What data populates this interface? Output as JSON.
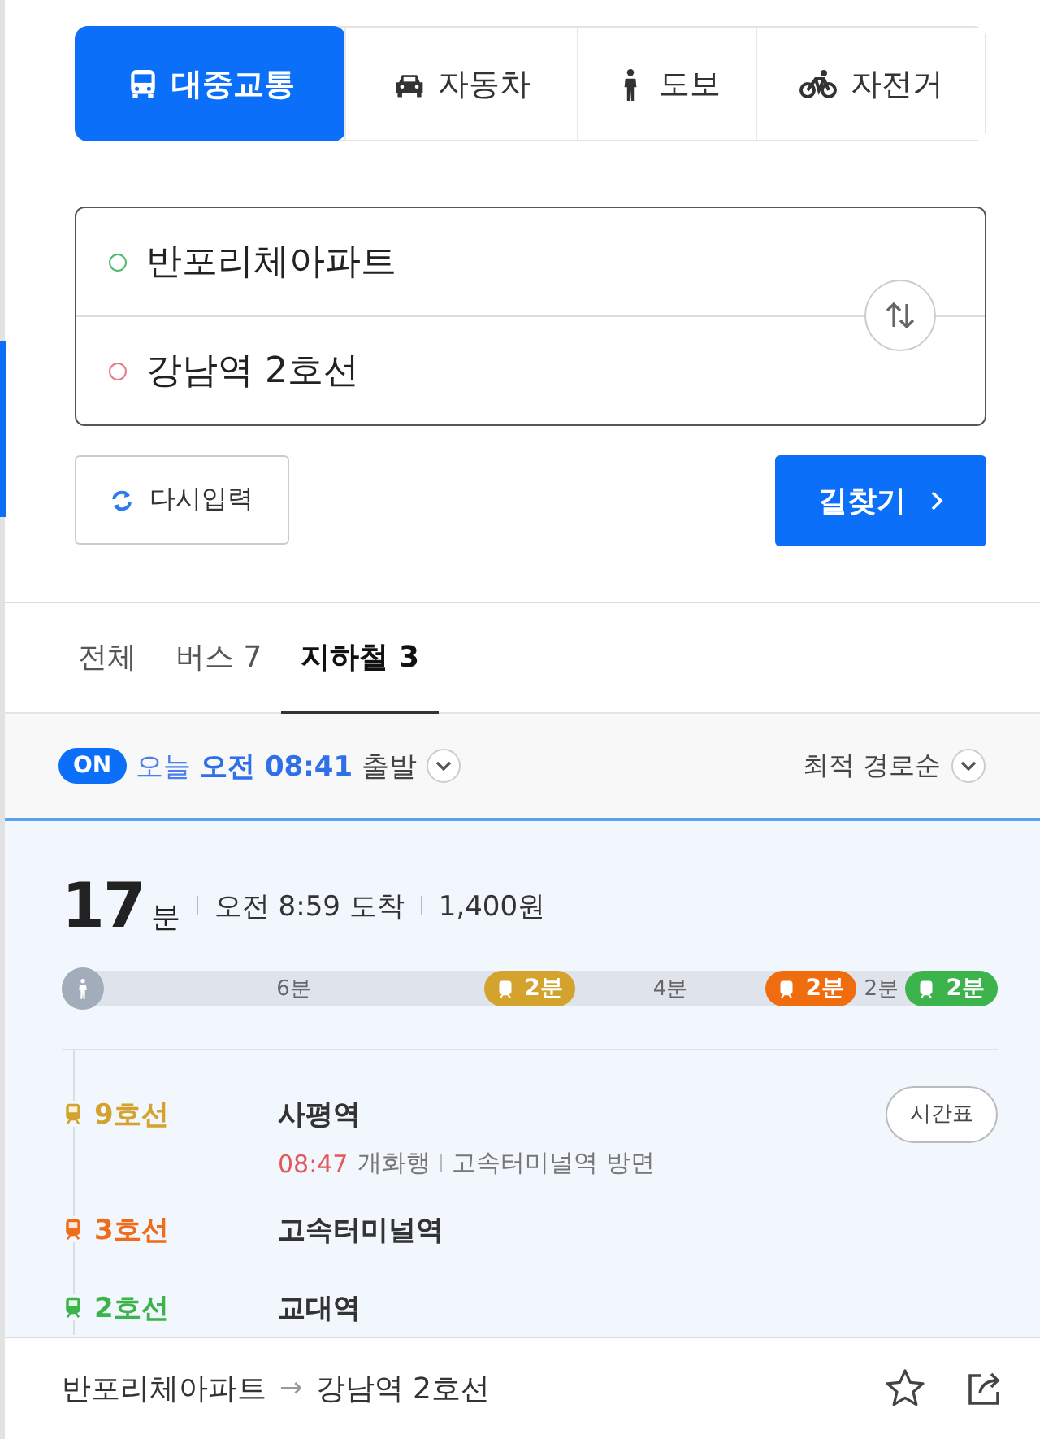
{
  "modes": [
    {
      "kind": "transit",
      "label": "대중교통",
      "selected": true
    },
    {
      "kind": "car",
      "label": "자동차",
      "selected": false
    },
    {
      "kind": "walk",
      "label": "도보",
      "selected": false
    },
    {
      "kind": "bike",
      "label": "자전거",
      "selected": false
    }
  ],
  "route_inputs": {
    "origin": "반포리체아파트",
    "destination": "강남역 2호선"
  },
  "reset_button": "다시입력",
  "search_button": "길찾기",
  "result_tabs": [
    {
      "label": "전체",
      "selected": false
    },
    {
      "label": "버스 7",
      "selected": false
    },
    {
      "label": "지하철 3",
      "selected": true
    }
  ],
  "departure": {
    "toggle": "ON",
    "on": true,
    "day": "오늘",
    "time": "오전 08:41",
    "suffix": "출발"
  },
  "sort": "최적 경로순",
  "route": {
    "duration": "17",
    "duration_unit": "분",
    "arrival": "오전 8:59 도착",
    "fare": "1,400원",
    "segments": [
      {
        "kind": "walk",
        "color": "#a3acbb",
        "label": "6분"
      },
      {
        "kind": "subway",
        "color": "#d4a32e",
        "badge": "2분",
        "label": "4분"
      },
      {
        "kind": "subway",
        "color": "#ef6c0f",
        "badge": "2분",
        "label": "2분"
      },
      {
        "kind": "subway",
        "color": "#3cb44b",
        "badge": "2분"
      }
    ],
    "steps": [
      {
        "line": "9호선",
        "color": "#d4a32e",
        "station": "사평역",
        "timetable": "시간표",
        "detail": {
          "time": "08:47",
          "direction": "개화행",
          "toward": "고속터미널역 방면"
        }
      },
      {
        "line": "3호선",
        "color": "#ef6c1a",
        "station": "고속터미널역"
      },
      {
        "line": "2호선",
        "color": "#3cb44b",
        "station": "교대역"
      }
    ]
  },
  "footer": {
    "from": "반포리체아파트",
    "arrow": "→",
    "to": "강남역 2호선"
  }
}
